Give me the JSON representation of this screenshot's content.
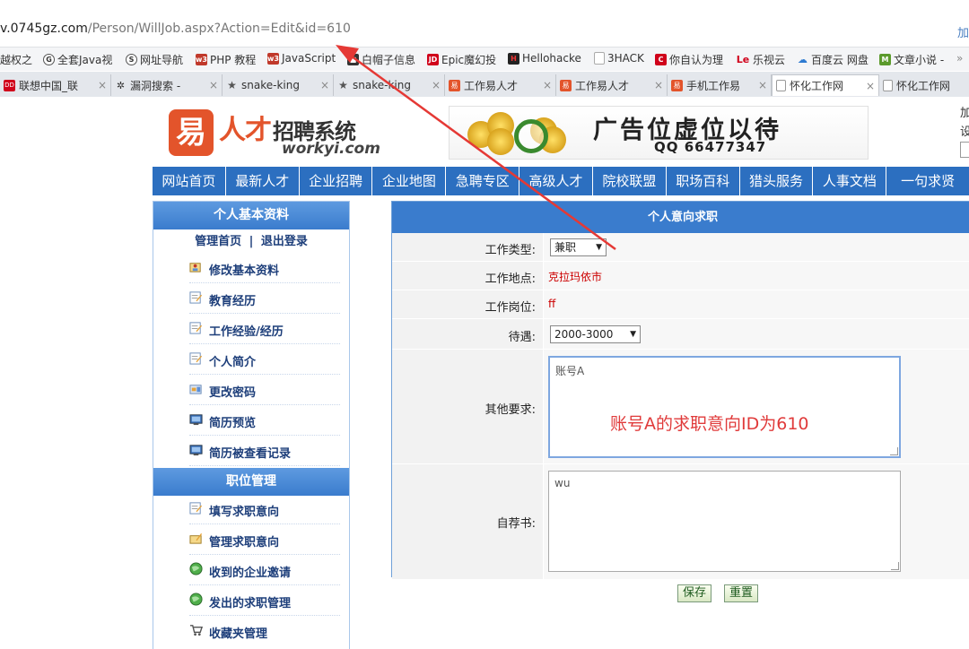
{
  "browser": {
    "url_host": "v.0745gz.com",
    "url_path": "/Person/WillJob.aspx?Action=Edit&id=610",
    "right_text": "加",
    "bookmarks": [
      {
        "label": "越权之",
        "icon": "bookmark-icon"
      },
      {
        "label": "全套Java视",
        "icon": "java-icon"
      },
      {
        "label": "网址导航",
        "icon": "nav-icon"
      },
      {
        "label": "PHP 教程",
        "icon": "w3-icon"
      },
      {
        "label": "JavaScript",
        "icon": "w3-icon"
      },
      {
        "label": "白帽子信息",
        "icon": "hat-icon"
      },
      {
        "label": "Epic魔幻投",
        "icon": "jd-icon"
      },
      {
        "label": "Hellohacke",
        "icon": "hacker-icon"
      },
      {
        "label": "3HACK",
        "icon": "page-icon"
      },
      {
        "label": "你自认为理",
        "icon": "c-icon"
      },
      {
        "label": "乐视云",
        "icon": "le-icon"
      },
      {
        "label": "百度云 网盘",
        "icon": "baidu-icon"
      },
      {
        "label": "文章小说 -",
        "icon": "m-icon"
      }
    ],
    "tabs": [
      {
        "label": "联想中国_联",
        "icon": "lenovo-icon",
        "active": false
      },
      {
        "label": "漏洞搜索 -",
        "icon": "bug-icon",
        "active": false
      },
      {
        "label": "snake-king",
        "icon": "github-icon",
        "active": false
      },
      {
        "label": "snake-king",
        "icon": "github-icon",
        "active": false
      },
      {
        "label": "工作易人才",
        "icon": "workyi-icon",
        "active": false
      },
      {
        "label": "工作易人才",
        "icon": "workyi-icon",
        "active": false
      },
      {
        "label": "手机工作易",
        "icon": "workyi-icon",
        "active": false
      },
      {
        "label": "怀化工作网",
        "icon": "page-icon",
        "active": true
      },
      {
        "label": "怀化工作网",
        "icon": "page-icon",
        "active": false
      }
    ]
  },
  "site": {
    "logo_mark": "易",
    "logo_name": "人才",
    "logo_system": "招聘系统",
    "logo_domain": "workyi.com",
    "ad_title": "广告位虚位以待",
    "ad_qq": "QQ 66477347",
    "login_side": [
      "加",
      "设"
    ],
    "nav": [
      "网站首页",
      "最新人才",
      "企业招聘",
      "企业地图",
      "急聘专区",
      "高级人才",
      "院校联盟",
      "职场百科",
      "猎头服务",
      "人事文档",
      "一句求贤"
    ]
  },
  "sidebar": {
    "section1_title": "个人基本资料",
    "home_link": "管理首页",
    "logout_link": "退出登录",
    "separator": "|",
    "items1": [
      {
        "label": "修改基本资料",
        "icon": "user-edit-icon"
      },
      {
        "label": "教育经历",
        "icon": "edit-icon"
      },
      {
        "label": "工作经验/经历",
        "icon": "edit-icon"
      },
      {
        "label": "个人简介",
        "icon": "edit-icon"
      },
      {
        "label": "更改密码",
        "icon": "key-icon"
      },
      {
        "label": "简历预览",
        "icon": "monitor-icon"
      },
      {
        "label": "简历被查看记录",
        "icon": "monitor-icon"
      }
    ],
    "section2_title": "职位管理",
    "items2": [
      {
        "label": "填写求职意向",
        "icon": "edit-icon"
      },
      {
        "label": "管理求职意向",
        "icon": "folder-edit-icon"
      },
      {
        "label": "收到的企业邀请",
        "icon": "globe-icon"
      },
      {
        "label": "发出的求职管理",
        "icon": "globe-icon"
      },
      {
        "label": "收藏夹管理",
        "icon": "cart-icon"
      }
    ]
  },
  "form": {
    "title": "个人意向求职",
    "job_type_label": "工作类型:",
    "job_type_value": "兼职",
    "location_label": "工作地点:",
    "location_value": "克拉玛依市",
    "position_label": "工作岗位:",
    "position_value": "ff",
    "salary_label": "待遇:",
    "salary_value": "2000-3000",
    "other_label": "其他要求:",
    "other_value": "账号A",
    "intro_label": "自荐书:",
    "intro_value": "wu",
    "save_button": "保存",
    "reset_button": "重置"
  },
  "annotation": {
    "text": "账号A的求职意向ID为610",
    "color": "#e03b3b"
  },
  "colors": {
    "nav_blue": "#2c6fc0",
    "panel_header": "#3a7ccd",
    "brand_orange": "#e3542b",
    "value_red": "#cc0000"
  }
}
